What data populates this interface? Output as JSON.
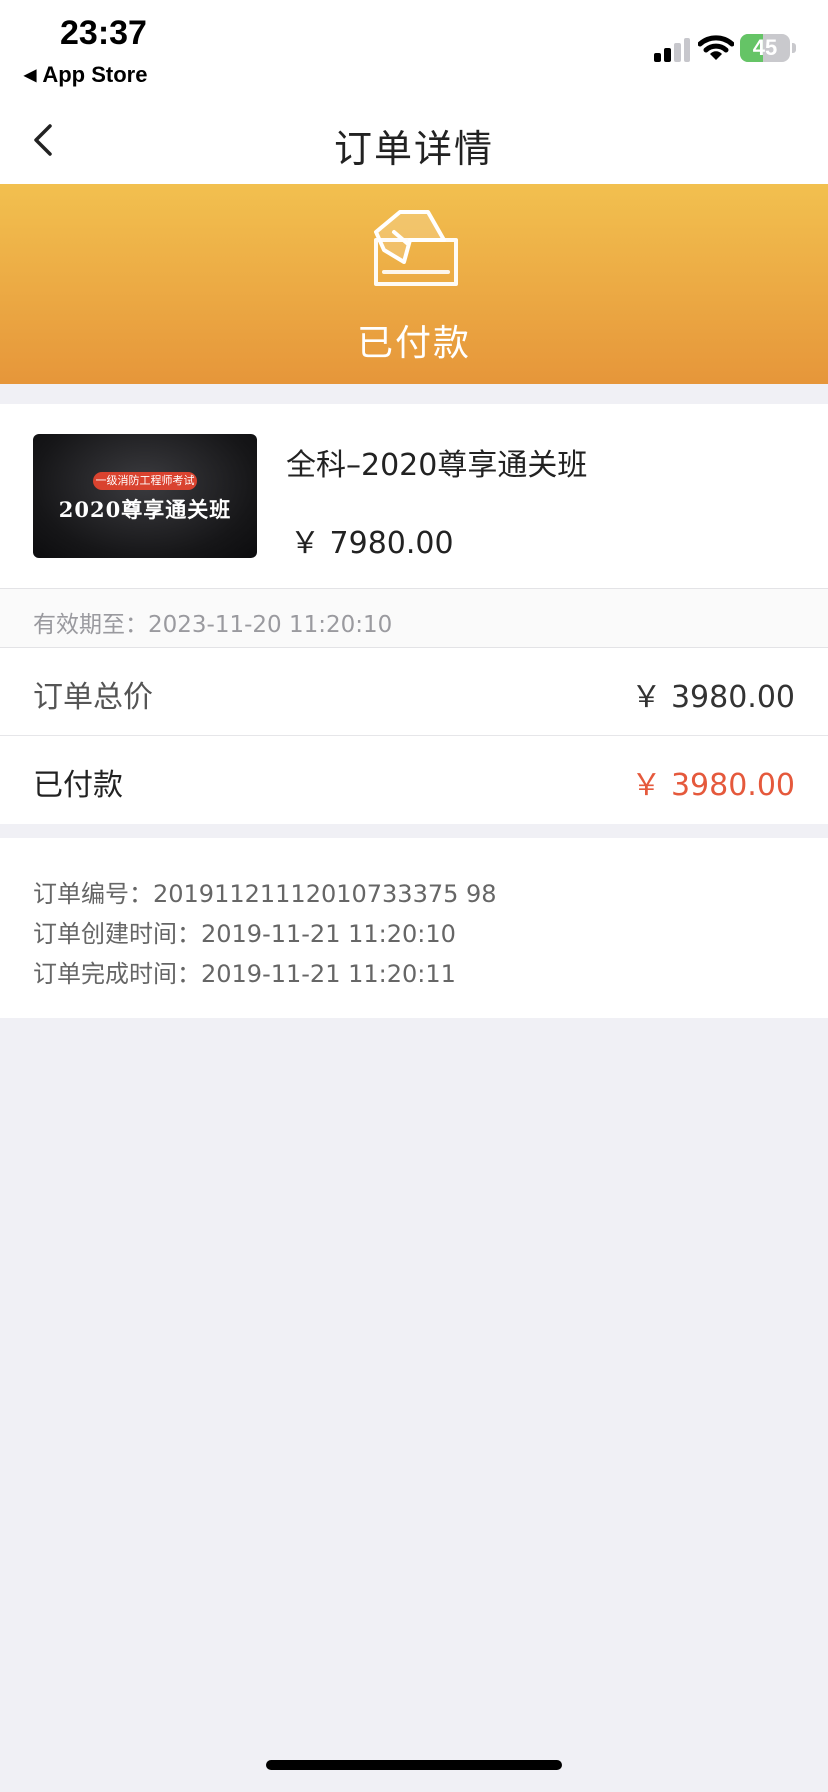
{
  "status_bar": {
    "time": "23:37",
    "back_app": "App Store",
    "battery_level": "45",
    "battery_fraction": 0.45,
    "battery_color": "#65c466"
  },
  "nav": {
    "title": "订单详情",
    "back_icon": "chevron-left-icon"
  },
  "banner": {
    "status": "已付款",
    "icon": "payment-card-icon",
    "gradient_top": "#f2c04f",
    "gradient_bottom": "#e6963a"
  },
  "product": {
    "thumb_tag": "一级消防工程师考试",
    "thumb_title": "2020尊享通关班",
    "name": "全科–2020尊享通关班",
    "price": "￥ 7980.00"
  },
  "validity": {
    "text": "有效期至：2023-11-20   11:20:10"
  },
  "amounts": {
    "total_label": "订单总价",
    "total_value": "￥ 3980.00",
    "paid_label": "已付款",
    "paid_value": "￥ 3980.00",
    "paid_color": "#e5593c"
  },
  "order_info": {
    "number": "订单编号：20191121112010733375 98",
    "created": "订单创建时间：2019-11-21   11:20:10",
    "completed": "订单完成时间：2019-11-21   11:20:11"
  }
}
